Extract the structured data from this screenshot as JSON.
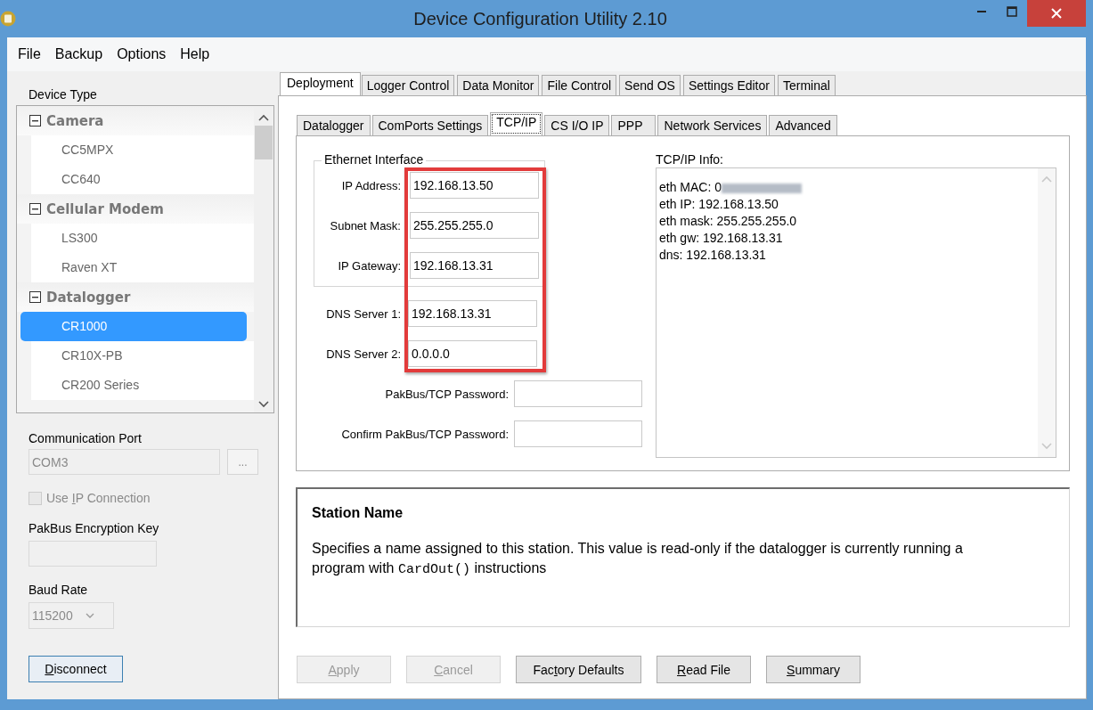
{
  "window": {
    "title": "Device Configuration Utility 2.10"
  },
  "menu": [
    "File",
    "Backup",
    "Options",
    "Help"
  ],
  "sidebar": {
    "device_type_label": "Device Type",
    "device_groups": [
      {
        "label": "Camera",
        "expanded": true,
        "items": [
          {
            "label": "CC5MPX",
            "selected": false
          },
          {
            "label": "CC640",
            "selected": false
          }
        ]
      },
      {
        "label": "Cellular Modem",
        "expanded": true,
        "items": [
          {
            "label": "LS300",
            "selected": false
          },
          {
            "label": "Raven XT",
            "selected": false
          }
        ]
      },
      {
        "label": "Datalogger",
        "expanded": true,
        "items": [
          {
            "label": "CR1000",
            "selected": true
          },
          {
            "label": "CR10X-PB",
            "selected": false
          },
          {
            "label": "CR200 Series",
            "selected": false
          }
        ]
      }
    ],
    "communication_port": {
      "label": "Communication Port",
      "value": "COM3",
      "disabled": true,
      "browse_button": "..."
    },
    "use_ip": {
      "label": {
        "before": "Use ",
        "key": "I",
        "after": "P Connection"
      },
      "checked": false,
      "disabled": true
    },
    "encryption_key": {
      "label": "PakBus Encryption Key",
      "disabled": true
    },
    "baud_rate": {
      "label": "Baud Rate",
      "value": "115200",
      "disabled": true
    },
    "disconnect_button": {
      "label": {
        "key": "D",
        "after": "isconnect"
      }
    }
  },
  "tabs": [
    {
      "label": "Deployment",
      "selected": true
    },
    {
      "label": "Logger Control",
      "selected": false
    },
    {
      "label": "Data Monitor",
      "selected": false
    },
    {
      "label": "File Control",
      "selected": false
    },
    {
      "label": "Send OS",
      "selected": false
    },
    {
      "label": "Settings Editor",
      "selected": false
    },
    {
      "label": "Terminal",
      "selected": false
    }
  ],
  "subtabs": [
    {
      "label": "Datalogger",
      "selected": false
    },
    {
      "label": "ComPorts Settings",
      "selected": false
    },
    {
      "label": "TCP/IP",
      "selected": true
    },
    {
      "label": "CS I/O IP",
      "selected": false
    },
    {
      "label": "PPP",
      "selected": false
    },
    {
      "label": "Network Services",
      "selected": false
    },
    {
      "label": "Advanced",
      "selected": false
    }
  ],
  "ethernet": {
    "title": "Ethernet Interface",
    "highlighted": true,
    "fields": [
      {
        "label": "IP Address:",
        "value": "192.168.13.50"
      },
      {
        "label": "Subnet Mask:",
        "value": "255.255.255.0"
      },
      {
        "label": "IP Gateway:",
        "value": "192.168.13.31"
      }
    ],
    "dns_fields": [
      {
        "label": "DNS Server 1:",
        "value": "192.168.13.31"
      },
      {
        "label": "DNS Server 2:",
        "value": "0.0.0.0"
      }
    ],
    "password_fields": [
      {
        "label": "PakBus/TCP Password:"
      },
      {
        "label": "Confirm PakBus/TCP Password:"
      }
    ]
  },
  "info": {
    "label": "TCP/IP Info:",
    "lines": [
      {
        "text": "eth MAC: 0",
        "redacted": true
      },
      {
        "text": "eth IP: 192.168.13.50",
        "redacted": false
      },
      {
        "text": "eth mask: 255.255.255.0",
        "redacted": false
      },
      {
        "text": "eth gw: 192.168.13.31",
        "redacted": false
      },
      {
        "text": "dns: 192.168.13.31",
        "redacted": false
      }
    ]
  },
  "help": {
    "title": "Station Name",
    "parts": [
      {
        "kind": "text",
        "text": "Specifies a name assigned to this station. This value is read-only if the datalogger is currently running a program with "
      },
      {
        "kind": "code",
        "text": "CardOut()"
      },
      {
        "kind": "text",
        "text": " instructions"
      }
    ]
  },
  "buttons": [
    {
      "label": {
        "key": "A",
        "after": "pply"
      },
      "disabled": true
    },
    {
      "label": {
        "key": "C",
        "after": "ancel"
      },
      "disabled": true
    },
    {
      "label": {
        "before": "Fac",
        "key": "t",
        "after": "ory Defaults"
      },
      "disabled": false
    },
    {
      "label": {
        "key": "R",
        "after": "ead File"
      },
      "disabled": false
    },
    {
      "label": {
        "key": "S",
        "after": "ummary"
      },
      "disabled": false
    }
  ]
}
